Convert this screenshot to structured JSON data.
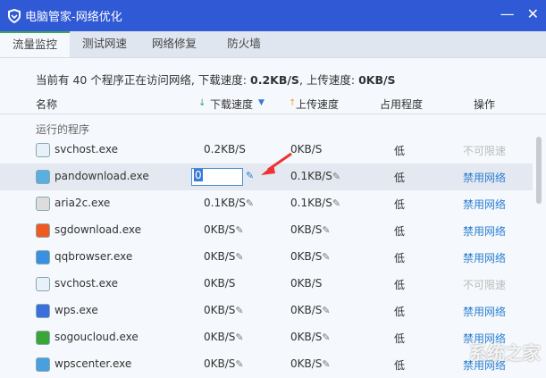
{
  "window": {
    "title": "电脑管家-网络优化",
    "minimize": "—",
    "close": "✕"
  },
  "tabs": [
    "流量监控",
    "测试网速",
    "网络修复",
    "防火墙"
  ],
  "summary": {
    "prefix": "当前有 40 个程序正在访问网络, 下载速度: ",
    "download": "0.2KB/S",
    "mid": ", 上传速度: ",
    "upload": "0KB/S"
  },
  "columns": {
    "name": "名称",
    "download": "下载速度",
    "upload": "上传速度",
    "occupancy": "占用程度",
    "action": "操作"
  },
  "section_label": "运行的程序",
  "rows": [
    {
      "name": "svchost.exe",
      "icon": "svchost-icon",
      "download": "0.2KB/S",
      "upload": "0KB/S",
      "occupancy": "低",
      "action": "不可限速",
      "editable": false
    },
    {
      "name": "pandownload.exe",
      "icon": "cloud-icon",
      "download": "0",
      "upload": "0.1KB/S",
      "occupancy": "低",
      "action": "禁用网络",
      "editable": true,
      "editing": true
    },
    {
      "name": "aria2c.exe",
      "icon": "app-icon",
      "download": "0.1KB/S",
      "upload": "0.1KB/S",
      "occupancy": "低",
      "action": "禁用网络",
      "editable": true
    },
    {
      "name": "sgdownload.exe",
      "icon": "sogou-icon",
      "download": "0KB/S",
      "upload": "0KB/S",
      "occupancy": "低",
      "action": "禁用网络",
      "editable": true
    },
    {
      "name": "qqbrowser.exe",
      "icon": "qqbrowser-icon",
      "download": "0KB/S",
      "upload": "0KB/S",
      "occupancy": "低",
      "action": "禁用网络",
      "editable": true
    },
    {
      "name": "svchost.exe",
      "icon": "svchost-icon",
      "download": "0KB/S",
      "upload": "0KB/S",
      "occupancy": "低",
      "action": "不可限速",
      "editable": false
    },
    {
      "name": "wps.exe",
      "icon": "wps-icon",
      "download": "0KB/S",
      "upload": "0KB/S",
      "occupancy": "低",
      "action": "禁用网络",
      "editable": true
    },
    {
      "name": "sogoucloud.exe",
      "icon": "sogoucloud-icon",
      "download": "0KB/S",
      "upload": "0KB/S",
      "occupancy": "低",
      "action": "禁用网络",
      "editable": true
    },
    {
      "name": "wpscenter.exe",
      "icon": "wpscenter-icon",
      "download": "0KB/S",
      "upload": "0KB/S",
      "occupancy": "低",
      "action": "禁用网络",
      "editable": true
    }
  ],
  "watermark": "系统之家",
  "colors": {
    "titlebar": "#2f59d5",
    "link": "#2a7fd0",
    "active_tab": "#3aa65a"
  }
}
